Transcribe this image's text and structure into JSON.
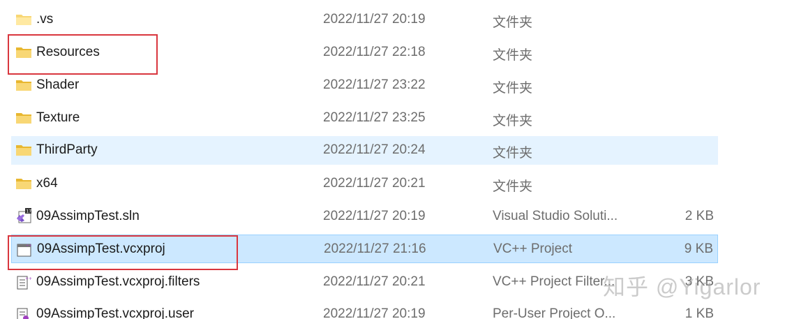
{
  "rows": [
    {
      "name": ".vs",
      "date": "2022/11/27 20:19",
      "type": "文件夹",
      "size": "",
      "icon": "folder-icon"
    },
    {
      "name": "Resources",
      "date": "2022/11/27 22:18",
      "type": "文件夹",
      "size": "",
      "icon": "folder-icon"
    },
    {
      "name": "Shader",
      "date": "2022/11/27 23:22",
      "type": "文件夹",
      "size": "",
      "icon": "folder-icon"
    },
    {
      "name": "Texture",
      "date": "2022/11/27 23:25",
      "type": "文件夹",
      "size": "",
      "icon": "folder-icon"
    },
    {
      "name": "ThirdParty",
      "date": "2022/11/27 20:24",
      "type": "文件夹",
      "size": "",
      "icon": "folder-icon"
    },
    {
      "name": "x64",
      "date": "2022/11/27 20:21",
      "type": "文件夹",
      "size": "",
      "icon": "folder-icon"
    },
    {
      "name": "09AssimpTest.sln",
      "date": "2022/11/27 20:19",
      "type": "Visual Studio Soluti...",
      "size": "2 KB",
      "icon": "vs-solution-icon"
    },
    {
      "name": "09AssimpTest.vcxproj",
      "date": "2022/11/27 21:16",
      "type": "VC++ Project",
      "size": "9 KB",
      "icon": "vcxproj-icon"
    },
    {
      "name": "09AssimpTest.vcxproj.filters",
      "date": "2022/11/27 20:21",
      "type": "VC++ Project Filter...",
      "size": "3 KB",
      "icon": "filters-file-icon"
    },
    {
      "name": "09AssimpTest.vcxproj.user",
      "date": "2022/11/27 20:19",
      "type": "Per-User Project O...",
      "size": "1 KB",
      "icon": "user-file-icon"
    }
  ],
  "watermark": "知乎 @Yigarlor",
  "colors": {
    "hover_row": "#e5f3ff",
    "selected_row": "#cce8ff",
    "annotation_box": "#d9363e",
    "folder": "#f8d775"
  }
}
